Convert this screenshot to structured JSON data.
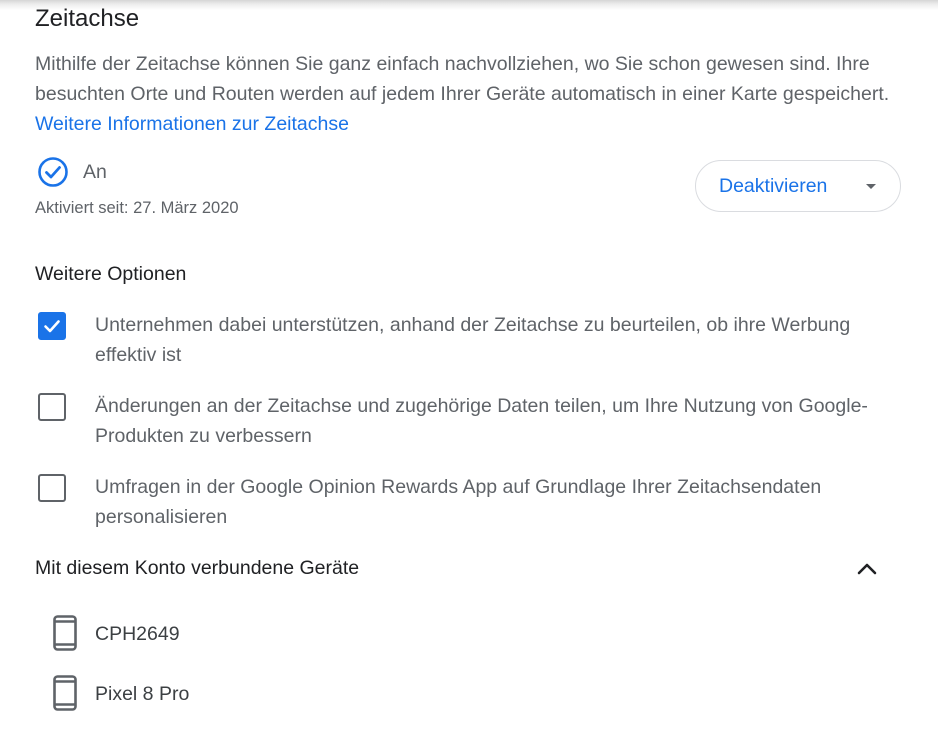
{
  "timeline": {
    "heading": "Zeitachse",
    "description": "Mithilfe der Zeitachse können Sie ganz einfach nachvollziehen, wo Sie schon gewesen sind. Ihre besuchten Orte und Routen werden auf jedem Ihrer Geräte automatisch in einer Karte gespeichert. ",
    "learn_more_link": "Weitere Informationen zur Zeitachse",
    "status": "An",
    "status_since": "Aktiviert seit: 27. März 2020",
    "deactivate_button": "Deaktivieren"
  },
  "more_options": {
    "title": "Weitere Optionen",
    "options": [
      {
        "label": "Unternehmen dabei unterstützen, anhand der Zeitachse zu beurteilen, ob ihre Werbung effektiv ist",
        "checked": true
      },
      {
        "label": "Änderungen an der Zeitachse und zugehörige Daten teilen, um Ihre Nutzung von Google-Produkten zu verbessern",
        "checked": false
      },
      {
        "label": "Umfragen in der Google Opinion Rewards App auf Grundlage Ihrer Zeitachsendaten personalisieren",
        "checked": false
      }
    ]
  },
  "devices": {
    "title": "Mit diesem Konto verbundene Geräte",
    "items": [
      {
        "name": "CPH2649",
        "icon": "phone-icon"
      },
      {
        "name": "Pixel 8 Pro",
        "icon": "phone-icon"
      }
    ]
  },
  "colors": {
    "accent": "#1a73e8",
    "text_secondary": "#5f6368",
    "text_primary": "#202124"
  }
}
